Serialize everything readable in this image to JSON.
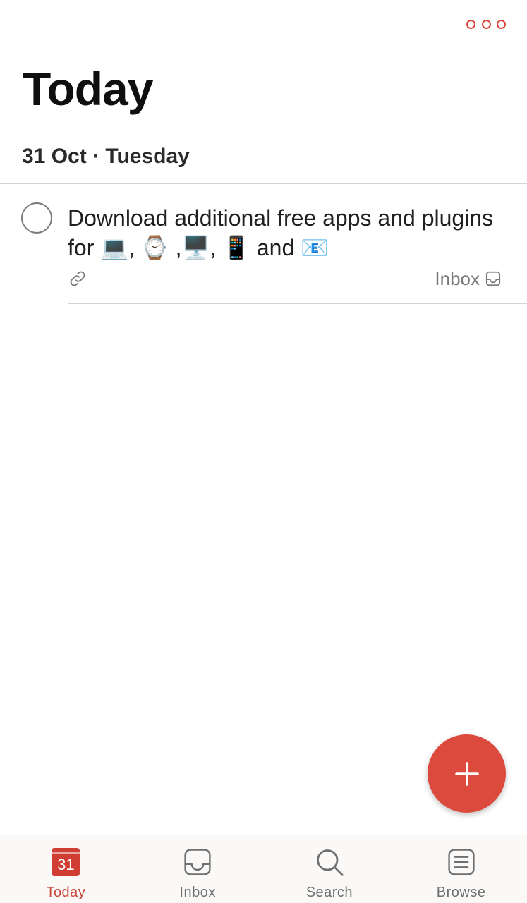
{
  "header": {
    "more_icon": "more-horizontal-icon",
    "title": "Today"
  },
  "section": {
    "date": "31 Oct",
    "separator": "·",
    "weekday": "Tuesday",
    "header_text": "31 Oct · Tuesday"
  },
  "tasks": [
    {
      "title": "Download additional free apps and plugins for 💻, ⌚ ,🖥️, 📱 and 📧",
      "completed": false,
      "has_link": true,
      "link_icon": "link-icon",
      "project": "Inbox",
      "project_icon": "inbox-icon"
    }
  ],
  "fab": {
    "icon": "plus-icon"
  },
  "tab_bar": {
    "items": [
      {
        "label": "Today",
        "icon": "calendar-icon",
        "badge": "31",
        "active": true
      },
      {
        "label": "Inbox",
        "icon": "inbox-icon",
        "active": false
      },
      {
        "label": "Search",
        "icon": "search-icon",
        "active": false
      },
      {
        "label": "Browse",
        "icon": "list-icon",
        "active": false
      }
    ]
  },
  "colors": {
    "accent": "#dc4a3d",
    "active_tab": "#c9483c",
    "inactive_tab": "#6f6f6f",
    "tab_bar_bg": "#fbf9f7",
    "divider": "#d4d4d4"
  }
}
